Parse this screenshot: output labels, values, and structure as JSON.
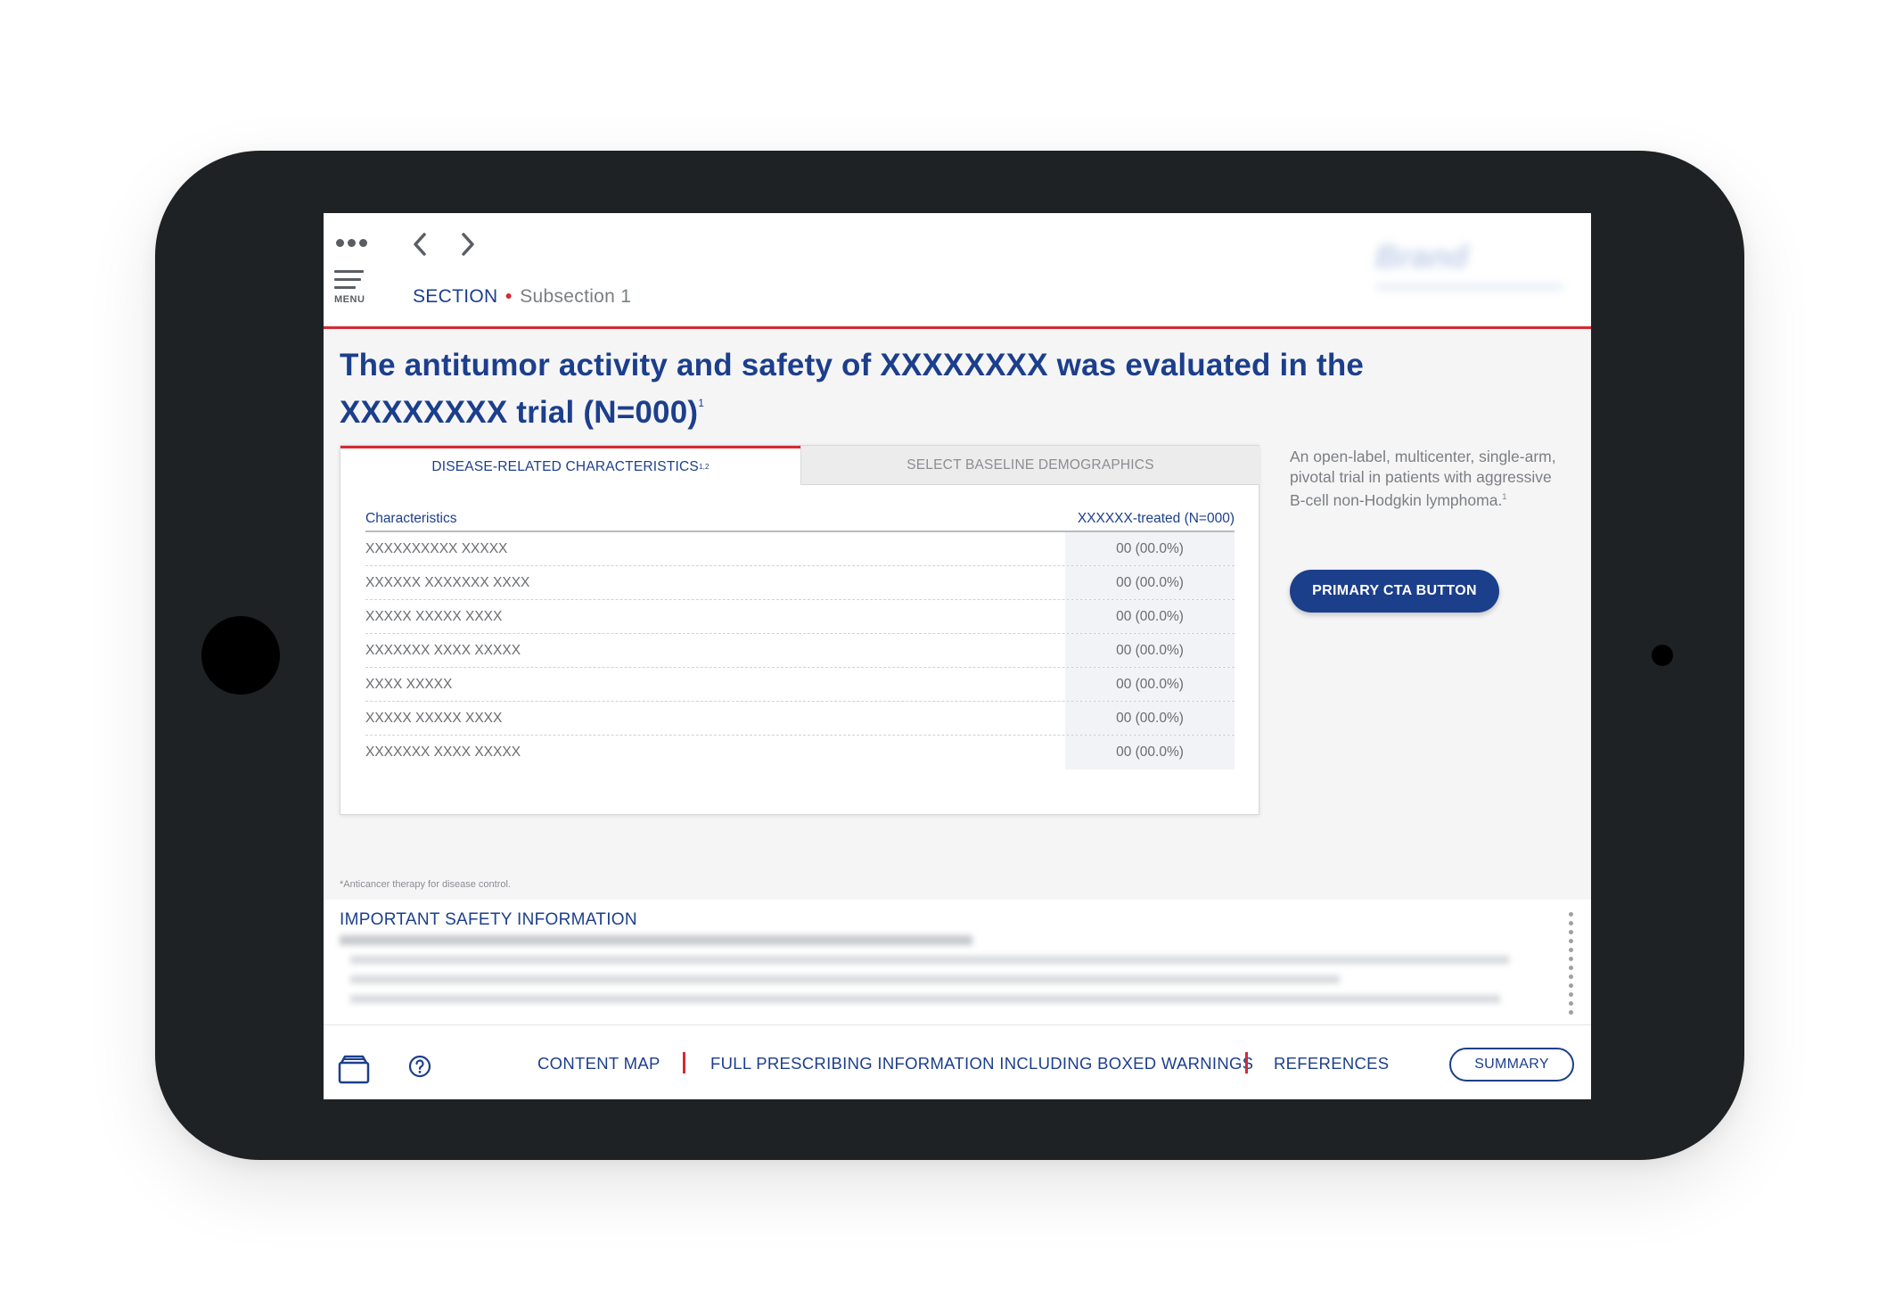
{
  "header": {
    "menu_label": "MENU",
    "section": "SECTION",
    "subsection": "Subsection 1",
    "logo_text": "Brand"
  },
  "title": {
    "line1": "The antitumor activity and safety of XXXXXXXX was evaluated in the",
    "line2": "XXXXXXXX trial (N=000)",
    "sup": "1"
  },
  "tabs": [
    {
      "label": "DISEASE-RELATED CHARACTERISTICS",
      "sup": "1,2",
      "active": true
    },
    {
      "label": "SELECT BASELINE DEMOGRAPHICS",
      "active": false
    }
  ],
  "table": {
    "headers": [
      "Characteristics",
      "XXXXXX-treated (N=000)"
    ],
    "rows": [
      {
        "label": "XXXXXXXXXX XXXXX",
        "value": "00 (00.0%)"
      },
      {
        "label": "XXXXXX XXXXXXX XXXX",
        "value": "00 (00.0%)"
      },
      {
        "label": "XXXXX XXXXX XXXX",
        "value": "00 (00.0%)"
      },
      {
        "label": "XXXXXXX XXXX XXXXX",
        "value": "00 (00.0%)"
      },
      {
        "label": "XXXX XXXXX",
        "value": "00 (00.0%)"
      },
      {
        "label": "XXXXX XXXXX XXXX",
        "value": "00 (00.0%)"
      },
      {
        "label": "XXXXXXX XXXX XXXXX",
        "value": "00 (00.0%)"
      }
    ]
  },
  "side": {
    "description": "An open-label, multicenter, single-arm, pivotal trial in patients with aggressive B-cell non-Hodgkin lymphoma.",
    "sup": "1",
    "cta_label": "PRIMARY CTA BUTTON"
  },
  "footnote": "*Anticancer therapy for disease control.",
  "isi": {
    "title": "IMPORTANT SAFETY INFORMATION"
  },
  "bottombar": {
    "links": [
      "CONTENT MAP",
      "FULL PRESCRIBING INFORMATION INCLUDING BOXED WARNINGS",
      "REFERENCES"
    ],
    "summary_label": "SUMMARY"
  },
  "colors": {
    "brand_blue": "#1c3f8c",
    "accent_red": "#d42a35",
    "device_frame": "#1e2224"
  }
}
